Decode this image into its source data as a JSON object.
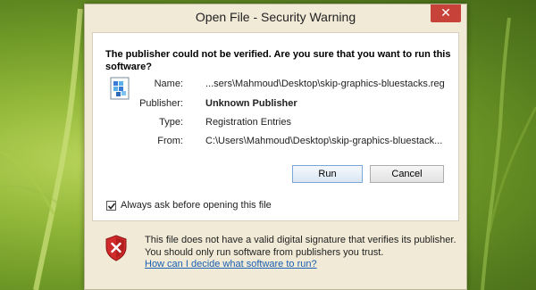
{
  "window": {
    "title": "Open File - Security Warning",
    "close_glyph": "✕"
  },
  "dialog": {
    "question": "The publisher could not be verified. Are you sure that you want to run this software?",
    "fields": [
      {
        "label": "Name:",
        "value": "...sers\\Mahmoud\\Desktop\\skip-graphics-bluestacks.reg"
      },
      {
        "label": "Publisher:",
        "value": "Unknown Publisher"
      },
      {
        "label": "Type:",
        "value": "Registration Entries"
      },
      {
        "label": "From:",
        "value": "C:\\Users\\Mahmoud\\Desktop\\skip-graphics-bluestack..."
      }
    ],
    "run_label": "Run",
    "cancel_label": "Cancel",
    "always_ask_label": "Always ask before opening this file",
    "always_ask_checked": true
  },
  "warning": {
    "text": "This file does not have a valid digital signature that verifies its publisher. You should only run software from publishers you trust.",
    "link": "How can I decide what software to run?"
  },
  "icons": {
    "file": "registry-file-icon",
    "warning": "shield-warning-icon",
    "check": "checkmark-icon"
  }
}
